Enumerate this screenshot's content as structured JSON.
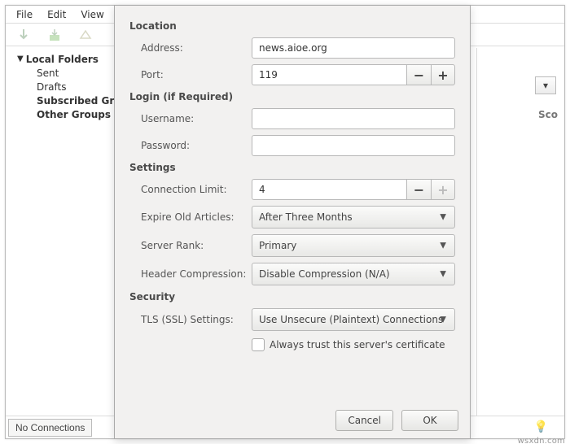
{
  "menubar": {
    "file": "File",
    "edit": "Edit",
    "view": "View"
  },
  "sidebar": {
    "root": "Local Folders",
    "items": [
      "Sent",
      "Drafts",
      "Subscribed Gr",
      "Other Groups"
    ]
  },
  "statusbar": {
    "connections": "No Connections"
  },
  "right": {
    "sco": "Sco"
  },
  "dialog": {
    "sections": {
      "location": "Location",
      "login": "Login (if Required)",
      "settings": "Settings",
      "security": "Security"
    },
    "labels": {
      "address": "Address:",
      "port": "Port:",
      "username": "Username:",
      "password": "Password:",
      "connlimit": "Connection Limit:",
      "expire": "Expire Old Articles:",
      "rank": "Server Rank:",
      "compression": "Header Compression:",
      "tls": "TLS (SSL) Settings:",
      "trust": "Always trust this server's certificate"
    },
    "values": {
      "address": "news.aioe.org",
      "port": "119",
      "username": "",
      "password": "",
      "connlimit": "4",
      "expire": "After Three Months",
      "rank": "Primary",
      "compression": "Disable Compression (N/A)",
      "tls": "Use Unsecure (Plaintext) Connections"
    },
    "buttons": {
      "cancel": "Cancel",
      "ok": "OK"
    }
  },
  "watermark": "wsxdn.com"
}
